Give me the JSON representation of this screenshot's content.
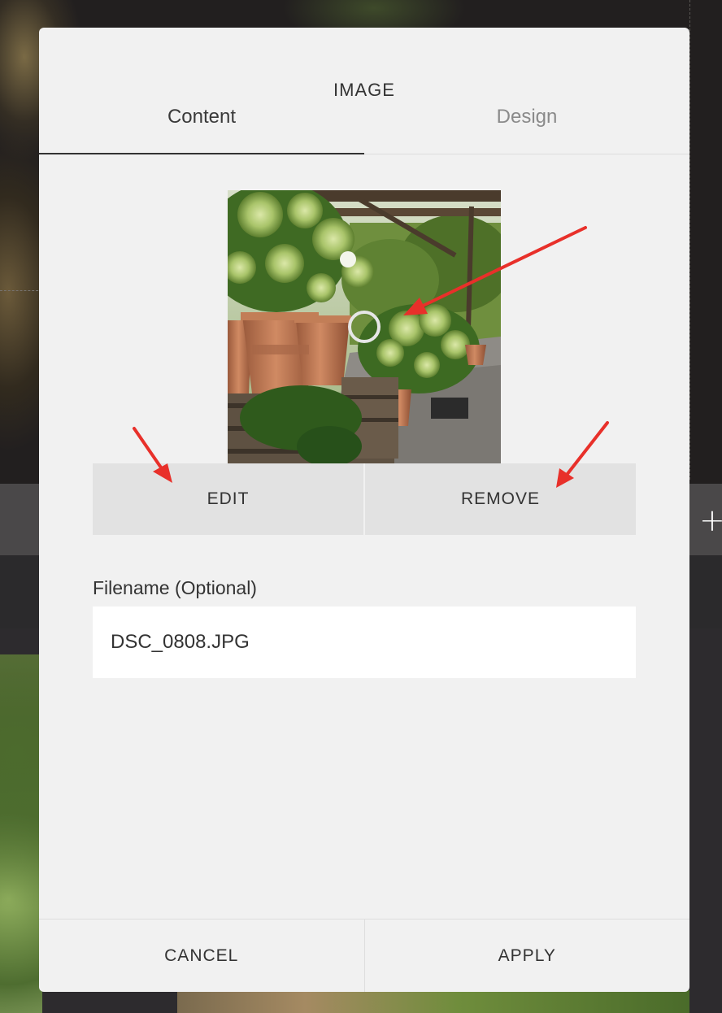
{
  "modal": {
    "title": "IMAGE",
    "tabs": [
      {
        "label": "Content",
        "active": true
      },
      {
        "label": "Design",
        "active": false
      }
    ],
    "image_buttons": {
      "edit_label": "EDIT",
      "remove_label": "REMOVE"
    },
    "filename": {
      "label": "Filename (Optional)",
      "value": "DSC_0808.JPG"
    },
    "footer": {
      "cancel_label": "CANCEL",
      "apply_label": "APPLY"
    }
  },
  "icons": {
    "plus": "plus-icon",
    "focal_point": "focal-point-icon",
    "annotation_arrow": "arrow-icon"
  },
  "colors": {
    "modal_bg": "#f1f1f1",
    "button_bg": "#e2e2e2",
    "annotation_arrow": "#e8302a",
    "text": "#333333"
  }
}
